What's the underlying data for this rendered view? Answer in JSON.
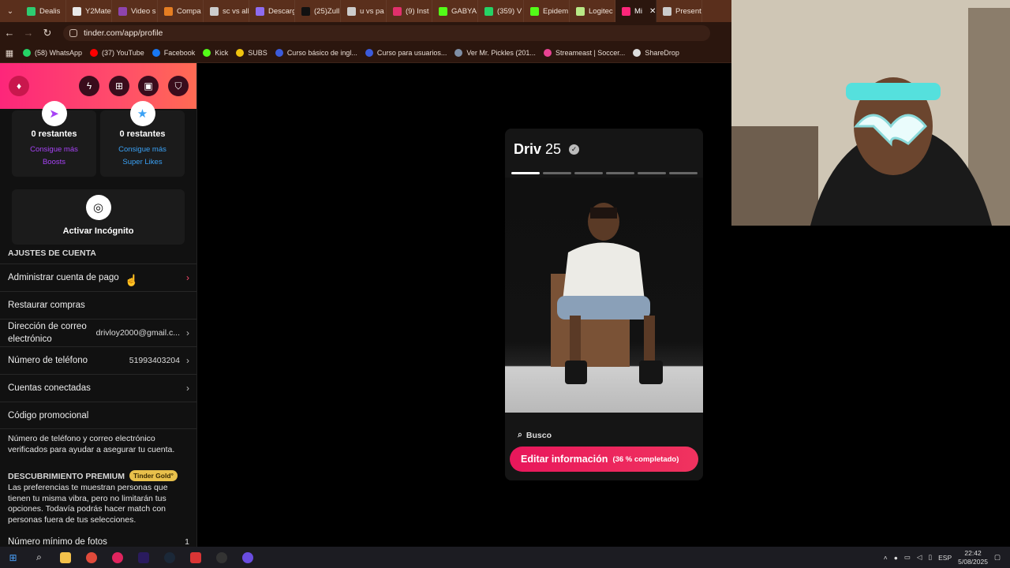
{
  "browser": {
    "tabs": [
      {
        "label": "Dealis",
        "color": "#2ecc71"
      },
      {
        "label": "Y2Mate",
        "color": "#e8e8e8"
      },
      {
        "label": "Video s",
        "color": "#8e44ad"
      },
      {
        "label": "Compa",
        "color": "#e67e22"
      },
      {
        "label": "sc vs all",
        "color": "#cccccc"
      },
      {
        "label": "Descarg",
        "color": "#8e6cf0"
      },
      {
        "label": "(25)Zull",
        "color": "#111111"
      },
      {
        "label": "u vs pa",
        "color": "#cccccc"
      },
      {
        "label": "(9) Inst",
        "color": "#e1306c"
      },
      {
        "label": "GABYA",
        "color": "#53fc18"
      },
      {
        "label": "(359) V",
        "color": "#25d366"
      },
      {
        "label": "Epidem",
        "color": "#53fc18"
      },
      {
        "label": "Logitec",
        "color": "#b8e986"
      },
      {
        "label": "Mi",
        "color": "#fd267a",
        "active": true
      },
      {
        "label": "Present",
        "color": "#cccccc"
      }
    ],
    "url": "tinder.com/app/profile",
    "bookmarks": [
      {
        "label": "(58) WhatsApp",
        "color": "#25d366"
      },
      {
        "label": "(37) YouTube",
        "color": "#ff0000"
      },
      {
        "label": "Facebook",
        "color": "#1877f2"
      },
      {
        "label": "Kick",
        "color": "#53fc18"
      },
      {
        "label": "SUBS",
        "color": "#f1c40f"
      },
      {
        "label": "Curso básico de ingl...",
        "color": "#3b5bdb"
      },
      {
        "label": "Curso para usuarios...",
        "color": "#3b5bdb"
      },
      {
        "label": "Ver Mr. Pickles (201...",
        "color": "#7f8fa6"
      },
      {
        "label": "Streameast | Soccer...",
        "color": "#e84393"
      },
      {
        "label": "ShareDrop",
        "color": "#dddddd"
      }
    ]
  },
  "sidebar": {
    "boosts": {
      "remaining": "0 restantes",
      "line1": "Consigue más",
      "line2": "Boosts",
      "color": "#a642f5"
    },
    "superlikes": {
      "remaining": "0 restantes",
      "line1": "Consigue más",
      "line2": "Super Likes",
      "color": "#3aa1f5"
    },
    "incognito": "Activar Incógnito",
    "account_section": "AJUSTES DE CUENTA",
    "rows": [
      {
        "label": "Administrar cuenta de pago",
        "value": ""
      },
      {
        "label": "Restaurar compras",
        "value": ""
      },
      {
        "label": "Dirección de correo electrónico",
        "value": "drivloy2000@gmail.c..."
      },
      {
        "label": "Número de teléfono",
        "value": "51993403204"
      },
      {
        "label": "Cuentas conectadas",
        "value": ""
      },
      {
        "label": "Código promocional",
        "value": ""
      }
    ],
    "verify_note": "Número de teléfono y correo electrónico verificados para ayudar a asegurar tu cuenta.",
    "premium_title": "DESCUBRIMIENTO PREMIUM",
    "premium_badge": "Tinder Gold°",
    "premium_note": "Las preferencias te muestran personas que tienen tu misma vibra, pero no limitarán tus opciones. Todavía podrás hacer match con personas fuera de tus selecciones.",
    "min_photos_label": "Número mínimo de fotos",
    "min_photos_value": "1"
  },
  "profile": {
    "name": "Driv",
    "age": "25",
    "photo_count": 6,
    "active_photo": 1,
    "search_label": "Busco",
    "edit_label": "Editar información",
    "edit_progress": "(36 % completado)"
  },
  "taskbar": {
    "lang": "ESP",
    "time": "22:42",
    "date": "5/08/2025"
  }
}
